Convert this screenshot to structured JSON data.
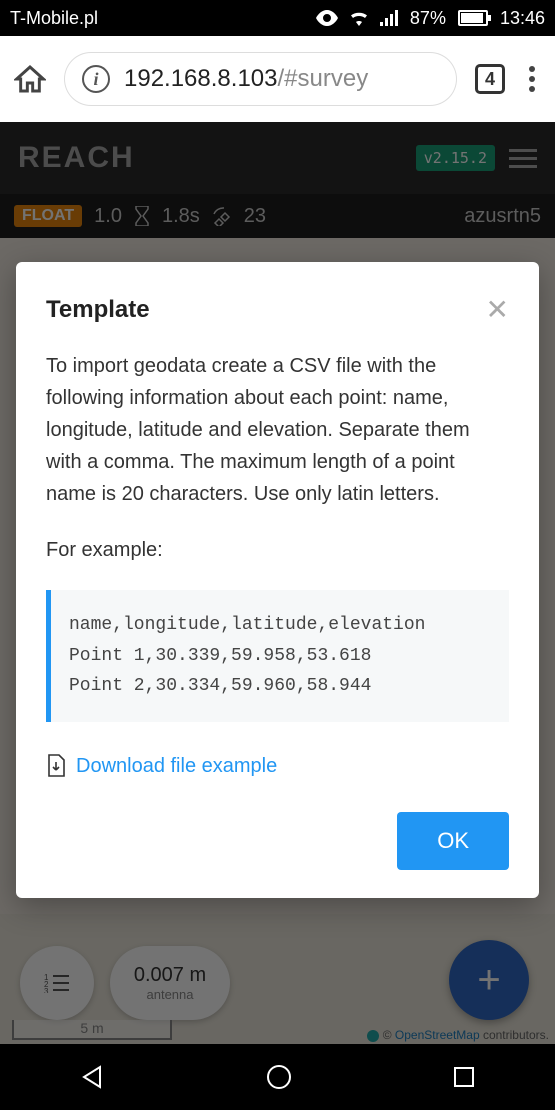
{
  "status_bar": {
    "carrier": "T-Mobile.pl",
    "battery_pct": "87%",
    "time": "13:46"
  },
  "browser": {
    "url_host": "192.168.8.103",
    "url_path": "/#survey",
    "tab_count": "4"
  },
  "app": {
    "logo": "REACH",
    "version": "v2.15.2",
    "status": {
      "float": "FLOAT",
      "age": "1.0",
      "time": "1.8s",
      "sats": "23",
      "user": "azusrtn5"
    },
    "map": {
      "antenna_value": "0.007 m",
      "antenna_label": "antenna",
      "scale": "5 m",
      "attribution_pre": "© ",
      "attribution_link": "OpenStreetMap",
      "attribution_post": " contributors."
    }
  },
  "modal": {
    "title": "Template",
    "body": "To import geodata create a CSV file with the following information about each point: name, longitude, latitude and elevation. Separate them with a comma. The maximum length of a point name is 20 characters. Use only latin letters.",
    "example_label": "For example:",
    "code": "name,longitude,latitude,elevation\nPoint 1,30.339,59.958,53.618\nPoint 2,30.334,59.960,58.944",
    "download_label": "Download file example",
    "ok": "OK"
  }
}
